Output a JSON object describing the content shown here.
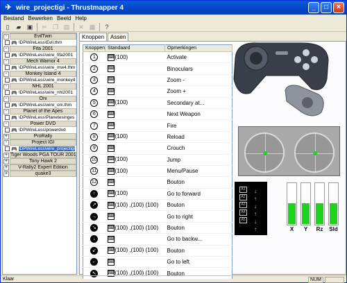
{
  "window": {
    "title": "wire_projectigi - Thrustmapper 4"
  },
  "menu": [
    "Bestand",
    "Bewerken",
    "Beeld",
    "Help"
  ],
  "toolbar": [
    "new-icon",
    "open-icon",
    "save-icon",
    "cut-icon",
    "copy-icon",
    "paste-icon",
    "delete-icon",
    "properties-icon",
    "help-icon"
  ],
  "games": [
    {
      "toggle": "-",
      "name": "EvilTwin",
      "file": "\\DPWireLess\\Evil.thm"
    },
    {
      "toggle": "-",
      "name": "Fifa 2001",
      "file": "\\DPWireLess\\wire_fifa2001"
    },
    {
      "toggle": "-",
      "name": "Mech Warrior 4",
      "file": "\\DPWireLess\\wire_mw4.thm"
    },
    {
      "toggle": "-",
      "name": "Monkey Island 4",
      "file": "\\DPWireLess\\wire_monkey4"
    },
    {
      "toggle": "-",
      "name": "NHL 2001",
      "file": "\\DPWireLess\\wire_nhl2001"
    },
    {
      "toggle": "-",
      "name": "Oni",
      "file": "\\DPWireLess\\wire_oni.thm"
    },
    {
      "toggle": "-",
      "name": "Planet of the Apes",
      "file": "\\DPWireLess\\Planetesinges"
    },
    {
      "toggle": "-",
      "name": "Power DVD",
      "file": "\\DPWireLess\\powerdvd"
    },
    {
      "toggle": "+",
      "name": "ProRally",
      "file": ""
    },
    {
      "toggle": "-",
      "name": "Project IGI",
      "file": "\\DPWireLess\\wire_projectigi",
      "selected": true
    },
    {
      "toggle": "+",
      "name": "Tiger Woods PGA TOUR 2001",
      "file": ""
    },
    {
      "toggle": "+",
      "name": "Tony Hawk 2",
      "file": ""
    },
    {
      "toggle": "+",
      "name": "V-Rally2 Expert Edition",
      "file": ""
    },
    {
      "toggle": "+",
      "name": "quake3",
      "file": ""
    }
  ],
  "tabs": [
    "Knoppen",
    "Assen"
  ],
  "table": {
    "headers": [
      "Knoppen",
      "Standaard",
      "Opmerkingen"
    ],
    "rows": [
      {
        "btn": "1",
        "dir": false,
        "std": "(100)",
        "rem": "Activate"
      },
      {
        "btn": "2",
        "dir": false,
        "std": "",
        "rem": "Binoculars"
      },
      {
        "btn": "3",
        "dir": false,
        "std": "",
        "rem": "Zoom -"
      },
      {
        "btn": "4",
        "dir": false,
        "std": "",
        "rem": "Zoom +"
      },
      {
        "btn": "5",
        "dir": false,
        "std": "(100)",
        "rem": "Secondary at..."
      },
      {
        "btn": "6",
        "dir": false,
        "std": "",
        "rem": "Next Weapon"
      },
      {
        "btn": "7",
        "dir": false,
        "std": "",
        "rem": "Fire"
      },
      {
        "btn": "8",
        "dir": false,
        "std": "(100)",
        "rem": "Reload"
      },
      {
        "btn": "9",
        "dir": false,
        "std": "",
        "rem": "Crouch"
      },
      {
        "btn": "10",
        "dir": false,
        "std": "(100)",
        "rem": "Jump"
      },
      {
        "btn": "11",
        "dir": false,
        "std": "(100)",
        "rem": "Menu/Pause"
      },
      {
        "btn": "12",
        "dir": false,
        "std": "",
        "rem": "Bouton"
      },
      {
        "btn": "↑",
        "dir": true,
        "std": "(100)",
        "rem": "Go to forward"
      },
      {
        "btn": "↗",
        "dir": true,
        "std": "(100) ,(100) (100)",
        "rem": "Bouton"
      },
      {
        "btn": "→",
        "dir": true,
        "std": "",
        "rem": "Go to right"
      },
      {
        "btn": "↘",
        "dir": true,
        "std": "(100) ,(100) (100)",
        "rem": "Bouton"
      },
      {
        "btn": "↓",
        "dir": true,
        "std": "",
        "rem": "Go to backw..."
      },
      {
        "btn": "↙",
        "dir": true,
        "std": "(100) ,(100) (100)",
        "rem": "Bouton"
      },
      {
        "btn": "←",
        "dir": true,
        "std": "",
        "rem": "Go to left"
      },
      {
        "btn": "↖",
        "dir": true,
        "std": "(100) ,(100) (100)",
        "rem": "Bouton"
      }
    ]
  },
  "axes": {
    "labels": [
      "X",
      "Y",
      "Rz",
      "Sld"
    ],
    "levels": [
      0.5,
      0.5,
      0.5,
      0.5
    ]
  },
  "status": {
    "left": "Klaar",
    "num": "NUM"
  }
}
